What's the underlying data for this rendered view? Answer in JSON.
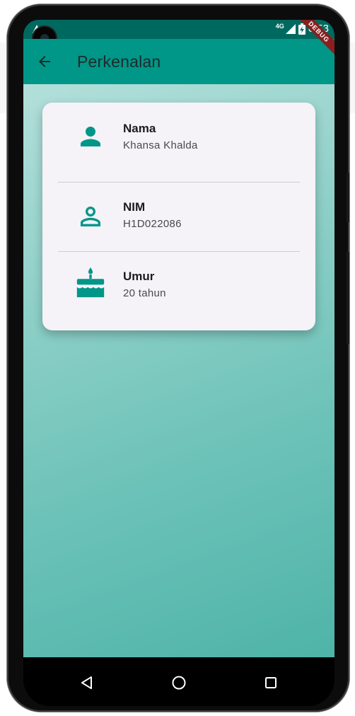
{
  "status_bar": {
    "network": "4G",
    "time": "6:53",
    "debug_banner": "DEBUG",
    "colors": {
      "background": "#00695f"
    }
  },
  "app_bar": {
    "title": "Perkenalan",
    "back_icon": "arrow-back-icon",
    "colors": {
      "background": "#009688"
    }
  },
  "card": {
    "items": [
      {
        "label": "Nama",
        "value": "Khansa Khalda",
        "icon": "person-icon"
      },
      {
        "label": "NIM",
        "value": "H1D022086",
        "icon": "person-outline-icon"
      },
      {
        "label": "Umur",
        "value": "20 tahun",
        "icon": "cake-icon"
      }
    ],
    "colors": {
      "icon": "#009688",
      "background": "#f5f2f8"
    }
  },
  "nav_bar": {
    "buttons": [
      "back-triangle-icon",
      "home-circle-icon",
      "recents-square-icon"
    ]
  }
}
